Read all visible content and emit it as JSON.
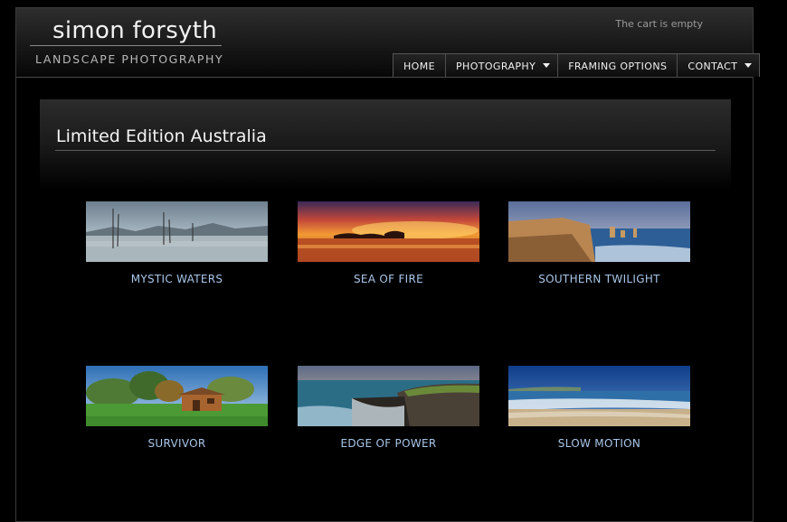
{
  "header": {
    "logo_name": "simon forsyth",
    "logo_tagline": "LANDSCAPE PHOTOGRAPHY",
    "cart_status": "The cart is empty"
  },
  "nav": [
    {
      "label": "HOME",
      "has_dropdown": false
    },
    {
      "label": "PHOTOGRAPHY",
      "has_dropdown": true
    },
    {
      "label": "FRAMING OPTIONS",
      "has_dropdown": false
    },
    {
      "label": "CONTACT",
      "has_dropdown": true
    }
  ],
  "page": {
    "title": "Limited Edition Australia"
  },
  "gallery": [
    {
      "title": "MYSTIC WATERS"
    },
    {
      "title": "SEA OF FIRE"
    },
    {
      "title": "SOUTHERN TWILIGHT"
    },
    {
      "title": "SURVIVOR"
    },
    {
      "title": "EDGE OF POWER"
    },
    {
      "title": "SLOW MOTION"
    }
  ],
  "colors": {
    "background": "#000000",
    "caption_link": "#a8c6e8",
    "title_text": "#f4f4f4"
  }
}
